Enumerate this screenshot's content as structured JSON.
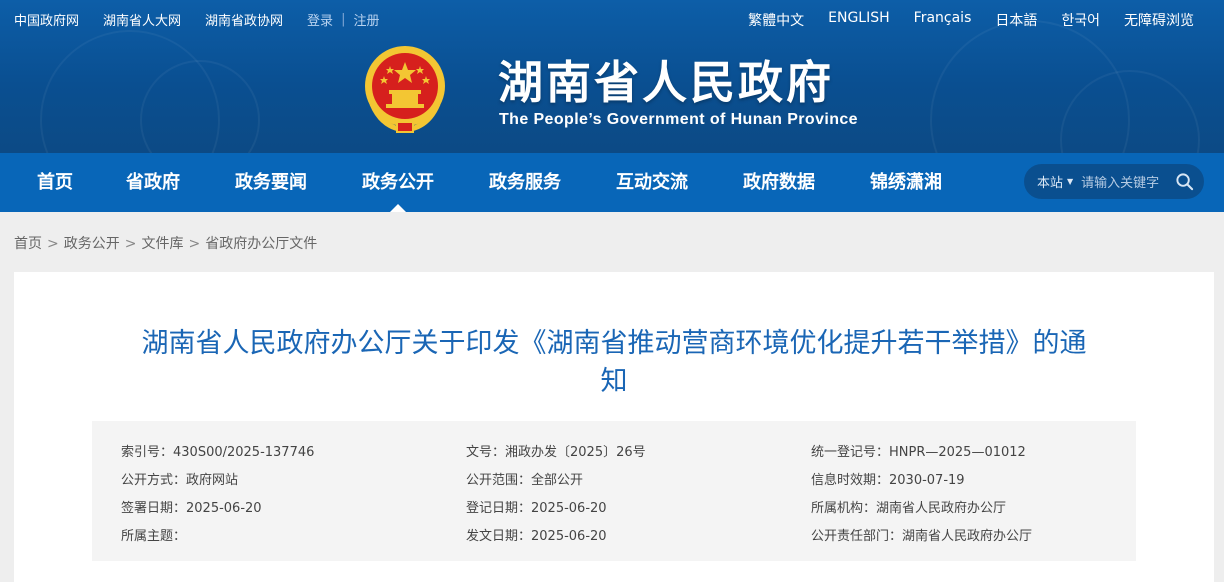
{
  "topbar": {
    "links": [
      "中国政府网",
      "湖南省人大网",
      "湖南省政协网"
    ],
    "login": "登录",
    "separator": "|",
    "register": "注册",
    "languages": [
      "繁體中文",
      "ENGLISH",
      "Français",
      "日本語",
      "한국어",
      "无障碍浏览"
    ]
  },
  "header": {
    "title_cn": "湖南省人民政府",
    "title_en": "The People’s Government of Hunan Province"
  },
  "nav": {
    "items": [
      "首页",
      "省政府",
      "政务要闻",
      "政务公开",
      "政务服务",
      "互动交流",
      "政府数据",
      "锦绣潇湘"
    ],
    "active": "政务公开"
  },
  "search": {
    "scope": "本站",
    "placeholder": "请输入关键字"
  },
  "breadcrumb": {
    "items": [
      "首页",
      "政务公开",
      "文件库",
      "省政府办公厅文件"
    ],
    "separator": ">"
  },
  "document": {
    "title_line1": "湖南省人民政府办公厅关于印发《湖南省推动营商环境优化提升若干举措》的通",
    "title_line2": "知",
    "meta": [
      [
        "索引号：430S00/2025-137746",
        "文号：湘政办发〔2025〕26号",
        "统一登记号：HNPR—2025—01012"
      ],
      [
        "公开方式：政府网站",
        "公开范围：全部公开",
        "信息时效期：2030-07-19"
      ],
      [
        "签署日期：2025-06-20",
        "登记日期：2025-06-20",
        "所属机构：湖南省人民政府办公厅"
      ],
      [
        "所属主题：",
        "发文日期：2025-06-20",
        "公开责任部门：湖南省人民政府办公厅"
      ]
    ]
  },
  "colors": {
    "header_blue": "#0a4f91",
    "nav_blue": "#0866b8",
    "title_blue": "#1a66b5",
    "emblem_red": "#d6201d",
    "emblem_gold": "#f3c633"
  }
}
